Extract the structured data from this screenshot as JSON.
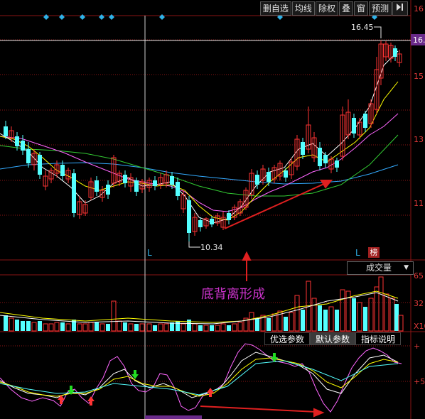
{
  "toolbar": {
    "delete_watch": "删自选",
    "ma": "均线",
    "ex_rights": "除权",
    "overlay": "叠",
    "window": "窗",
    "forecast": "预测",
    "play_icon": "play-to-end-icon"
  },
  "price_axis": {
    "top": "16",
    "p15": "15",
    "p13": "13",
    "p11": "11",
    "current": "16."
  },
  "labels": {
    "high": "16.45",
    "low": "10.34",
    "mark_l1": "L",
    "mark_l2": "L",
    "badge": "榜"
  },
  "volume": {
    "dropdown": "成交量",
    "axis_65": "65",
    "axis_32": "32",
    "axis_x10": "X10"
  },
  "indicator": {
    "params_preferred": "优选参数",
    "params_default": "默认参数",
    "params_help": "指标说明",
    "axis_top": "+",
    "axis_5": "+5"
  },
  "annotation": "底背离形成",
  "colors": {
    "up": "#ff3333",
    "down": "#54ffff",
    "ma5": "#ffffff",
    "ma10": "#ffff00",
    "ma20": "#ff66ff",
    "ma30": "#33cc33",
    "ma60": "#33aaff",
    "annotation": "#cc33cc",
    "arrow": "#e02020"
  }
}
